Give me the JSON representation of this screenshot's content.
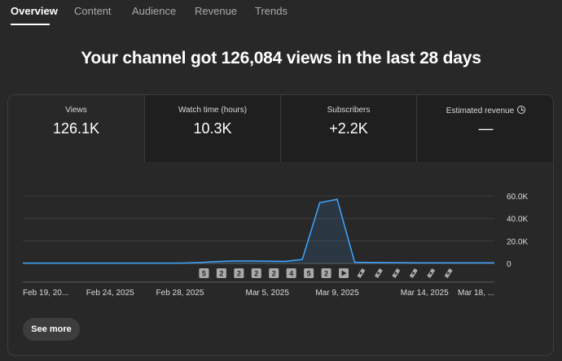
{
  "tabs": [
    {
      "label": "Overview",
      "active": true
    },
    {
      "label": "Content",
      "active": false
    },
    {
      "label": "Audience",
      "active": false
    },
    {
      "label": "Revenue",
      "active": false
    },
    {
      "label": "Trends",
      "active": false
    }
  ],
  "headline": "Your channel got 126,084 views in the last 28 days",
  "metrics": [
    {
      "label": "Views",
      "value": "126.1K",
      "selected": true
    },
    {
      "label": "Watch time (hours)",
      "value": "10.3K",
      "selected": false
    },
    {
      "label": "Subscribers",
      "value": "+2.2K",
      "selected": false
    },
    {
      "label": "Estimated revenue",
      "value": "—",
      "selected": false,
      "icon": "clock-icon"
    }
  ],
  "chart_data": {
    "type": "area",
    "x": [
      "Feb 19, 2025",
      "Feb 20, 2025",
      "Feb 21, 2025",
      "Feb 22, 2025",
      "Feb 23, 2025",
      "Feb 24, 2025",
      "Feb 25, 2025",
      "Feb 26, 2025",
      "Feb 27, 2025",
      "Feb 28, 2025",
      "Mar 1, 2025",
      "Mar 2, 2025",
      "Mar 3, 2025",
      "Mar 4, 2025",
      "Mar 5, 2025",
      "Mar 6, 2025",
      "Mar 7, 2025",
      "Mar 8, 2025",
      "Mar 9, 2025",
      "Mar 10, 2025",
      "Mar 11, 2025",
      "Mar 12, 2025",
      "Mar 13, 2025",
      "Mar 14, 2025",
      "Mar 15, 2025",
      "Mar 16, 2025",
      "Mar 17, 2025",
      "Mar 18, 2025"
    ],
    "values": [
      300,
      300,
      300,
      300,
      300,
      300,
      300,
      300,
      300,
      300,
      700,
      1500,
      2200,
      2200,
      2000,
      1800,
      3500,
      54000,
      57000,
      1000,
      800,
      700,
      600,
      500,
      500,
      500,
      500,
      500
    ],
    "ylim": [
      0,
      60000
    ],
    "yticks": [
      "60.0K",
      "40.0K",
      "20.0K",
      "0"
    ],
    "ytick_values": [
      60000,
      40000,
      20000,
      0
    ],
    "xtick_labels": [
      "Feb 19, 20...",
      "Feb 24, 2025",
      "Feb 28, 2025",
      "Mar 5, 2025",
      "Mar 9, 2025",
      "Mar 14, 2025",
      "Mar 18, ..."
    ],
    "xtick_indices": [
      0,
      5,
      9,
      14,
      18,
      23,
      27
    ],
    "grid": true,
    "line_color": "#3ea6ff",
    "fill_color": "#3ea6ff",
    "markers": [
      {
        "index": 10,
        "type": "count",
        "label": "5"
      },
      {
        "index": 11,
        "type": "count",
        "label": "2"
      },
      {
        "index": 12,
        "type": "count",
        "label": "2"
      },
      {
        "index": 13,
        "type": "count",
        "label": "2"
      },
      {
        "index": 14,
        "type": "count",
        "label": "2"
      },
      {
        "index": 15,
        "type": "count",
        "label": "4"
      },
      {
        "index": 16,
        "type": "count",
        "label": "5"
      },
      {
        "index": 17,
        "type": "count",
        "label": "2"
      },
      {
        "index": 18,
        "type": "video",
        "icon": "play-icon"
      },
      {
        "index": 19,
        "type": "short",
        "icon": "shorts-icon"
      },
      {
        "index": 20,
        "type": "short",
        "icon": "shorts-icon"
      },
      {
        "index": 21,
        "type": "short",
        "icon": "shorts-icon"
      },
      {
        "index": 22,
        "type": "short",
        "icon": "shorts-icon"
      },
      {
        "index": 23,
        "type": "short",
        "icon": "shorts-icon"
      },
      {
        "index": 24,
        "type": "short",
        "icon": "shorts-icon"
      }
    ]
  },
  "see_more_label": "See more",
  "colors": {
    "background": "#282828",
    "tile_inactive": "#1f1f1f",
    "border": "#3d3d3d",
    "text_secondary": "#aaaaaa",
    "accent": "#3ea6ff"
  }
}
